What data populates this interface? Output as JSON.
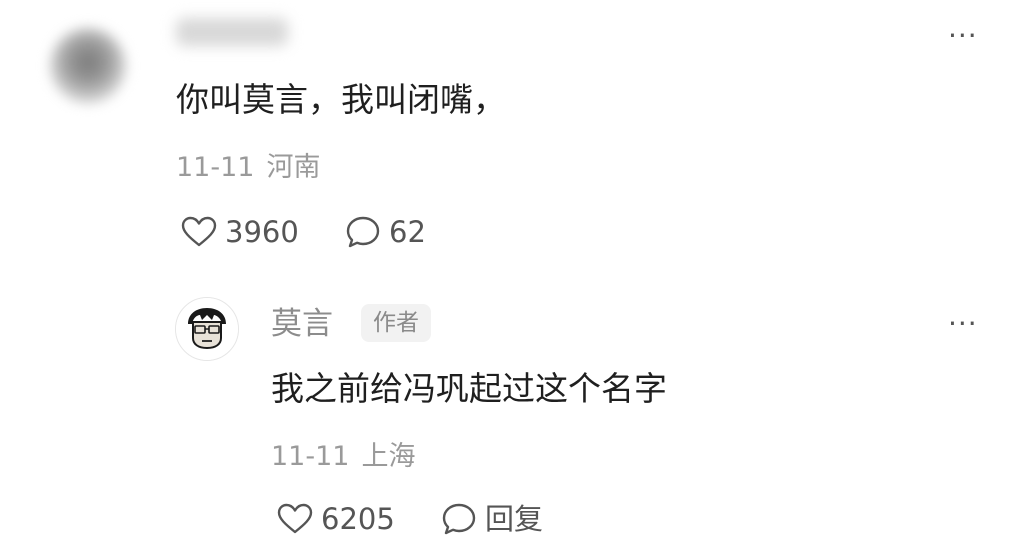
{
  "comment": {
    "text": "你叫莫言，我叫闭嘴，",
    "date": "11-11",
    "location": "河南",
    "likes": "3960",
    "replies": "62",
    "more_label": "···"
  },
  "reply": {
    "username": "莫言",
    "badge": "作者",
    "text": "我之前给冯巩起过这个名字",
    "date": "11-11",
    "location": "上海",
    "likes": "6205",
    "reply_label": "回复",
    "more_label": "···"
  }
}
